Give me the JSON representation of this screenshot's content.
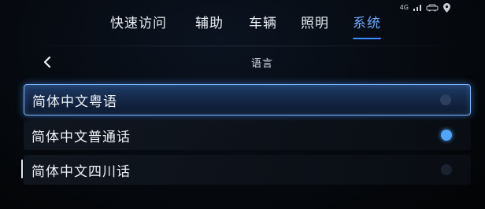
{
  "tabs": [
    {
      "label": "快速访问",
      "active": false
    },
    {
      "label": "辅助",
      "active": false
    },
    {
      "label": "车辆",
      "active": false
    },
    {
      "label": "照明",
      "active": false
    },
    {
      "label": "系统",
      "active": true
    }
  ],
  "status": {
    "network_label": "4G",
    "icons": [
      "network-icon",
      "car-status-icon",
      "location-icon"
    ]
  },
  "header": {
    "title": "语言",
    "back_icon": "chevron-left-icon"
  },
  "options": [
    {
      "label": "简体中文粤语",
      "highlighted": true,
      "selected": false
    },
    {
      "label": "简体中文普通话",
      "highlighted": false,
      "selected": true
    },
    {
      "label": "简体中文四川话",
      "highlighted": false,
      "selected": false
    }
  ],
  "colors": {
    "accent": "#4fa6ff",
    "active_tab": "#6aa9ff",
    "highlight_border": "#7bb6ff"
  }
}
